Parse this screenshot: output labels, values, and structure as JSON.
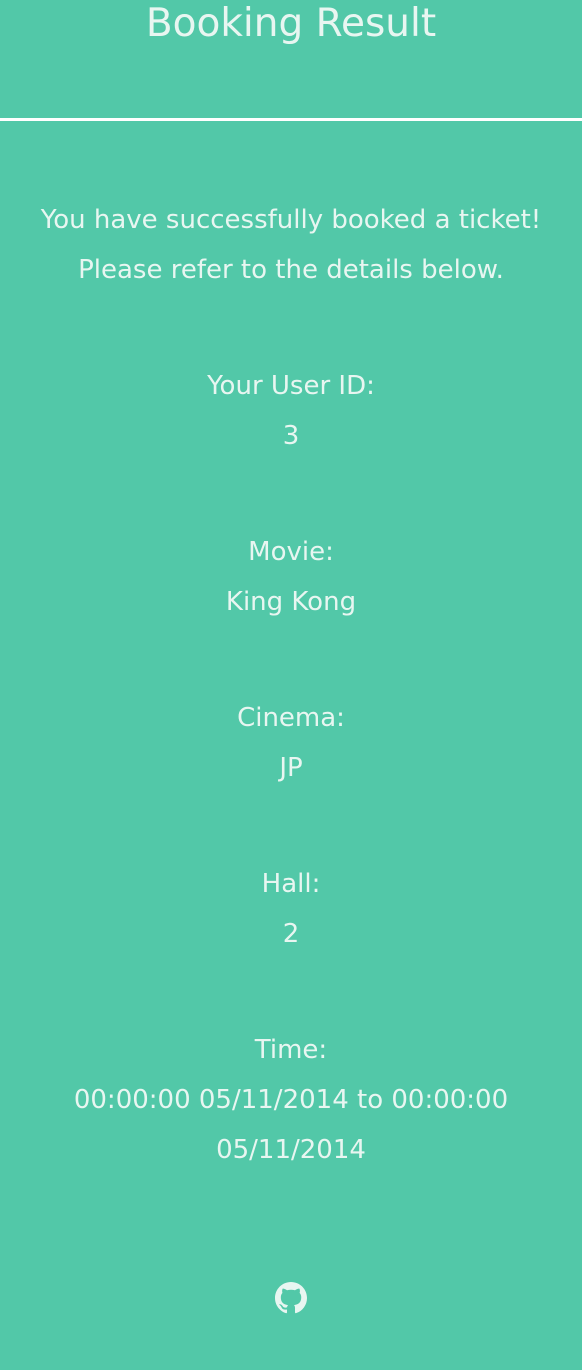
{
  "header": {
    "title": "Booking Result"
  },
  "message": {
    "line1": "You have successfully booked a ticket!",
    "line2": "Please refer to the details below."
  },
  "details": {
    "user_id": {
      "label": "Your User ID:",
      "value": "3"
    },
    "movie": {
      "label": "Movie:",
      "value": "King Kong"
    },
    "cinema": {
      "label": "Cinema:",
      "value": "JP"
    },
    "hall": {
      "label": "Hall:",
      "value": "2"
    },
    "time": {
      "label": "Time:",
      "value": "00:00:00 05/11/2014 to 00:00:00 05/11/2014"
    }
  },
  "footer": {
    "icon": "github-icon"
  },
  "colors": {
    "background": "#52c8a8",
    "text": "#e8f6f1",
    "divider": "#ffffff"
  }
}
